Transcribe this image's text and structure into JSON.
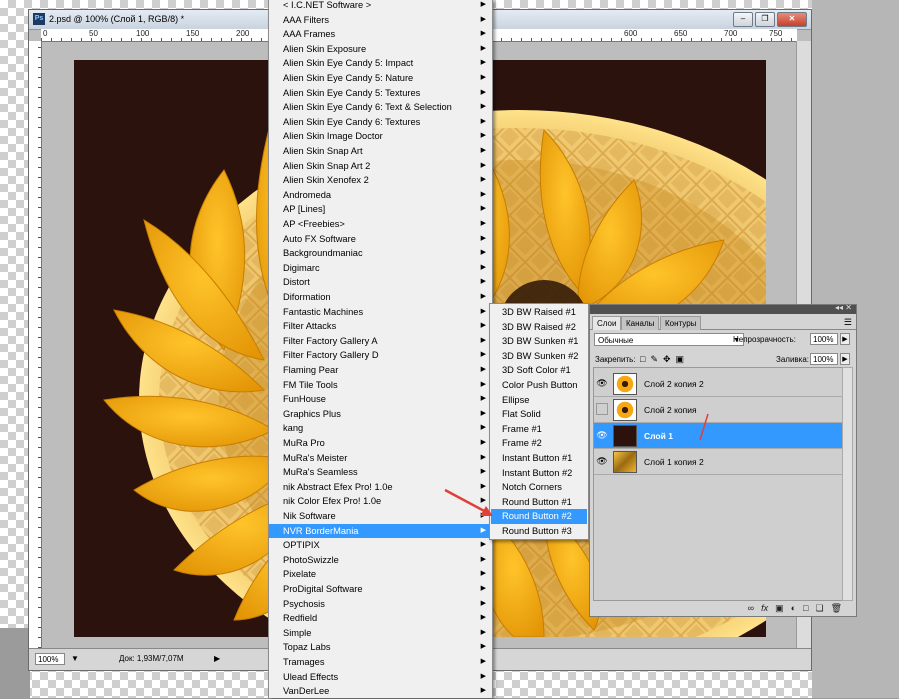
{
  "document": {
    "title": "2.psd @ 100% (Слой 1, RGB/8) *",
    "app_icon": "Ps",
    "ruler_labels": [
      "0",
      "50",
      "100",
      "150",
      "200",
      "250",
      "600",
      "650",
      "700",
      "750",
      "800",
      "850",
      "900"
    ],
    "zoom": "100%",
    "doc_info": "Док: 1,93M/7,07M",
    "canvas_color": "#2b120c"
  },
  "filter_menu": {
    "items": [
      "< I.C.NET Software >",
      "AAA Filters",
      "AAA Frames",
      "Alien Skin Exposure",
      "Alien Skin Eye Candy 5: Impact",
      "Alien Skin Eye Candy 5: Nature",
      "Alien Skin Eye Candy 5: Textures",
      "Alien Skin Eye Candy 6: Text & Selection",
      "Alien Skin Eye Candy 6: Textures",
      "Alien Skin Image Doctor",
      "Alien Skin Snap Art",
      "Alien Skin Snap Art 2",
      "Alien Skin Xenofex 2",
      "Andromeda",
      "AP [Lines]",
      "AP <Freebies>",
      "Auto FX Software",
      "Backgroundmaniac",
      "Digimarc",
      "Distort",
      "Diformation",
      "Fantastic Machines",
      "Filter Attacks",
      "Filter Factory Gallery A",
      "Filter Factory Gallery D",
      "Flaming Pear",
      "FM Tile Tools",
      "FunHouse",
      "Graphics Plus",
      "kang",
      "MuRa Pro",
      "MuRa's Meister",
      "MuRa's Seamless",
      "nik Abstract Efex Pro! 1.0e",
      "nik Color Efex Pro! 1.0e",
      "Nik Software",
      "NVR BorderMania",
      "OPTIPIX",
      "PhotoSwizzle",
      "Pixelate",
      "ProDigital Software",
      "Psychosis",
      "Redfield",
      "Simple",
      "Topaz Labs",
      "Tramages",
      "Ulead Effects",
      "VanDerLee"
    ],
    "highlighted": "NVR BorderMania"
  },
  "submenu": {
    "items": [
      "3D BW Raised #1",
      "3D BW Raised #2",
      "3D BW Sunken #1",
      "3D BW Sunken #2",
      "3D Soft Color #1",
      "Color Push Button",
      "Ellipse",
      "Flat Solid",
      "Frame #1",
      "Frame #2",
      "Instant Button #1",
      "Instant Button #2",
      "Notch Corners",
      "Round Button #1",
      "Round Button #2",
      "Round Button #3"
    ],
    "highlighted": "Round Button #2"
  },
  "layers_panel": {
    "tabs": [
      "Слои",
      "Каналы",
      "Контуры"
    ],
    "blend_mode": "Обычные",
    "opacity_label": "Непрозрачность:",
    "opacity": "100%",
    "lock_label": "Закрепить:",
    "fill_label": "Заливка:",
    "fill": "100%",
    "layers": [
      {
        "name": "Слой 2 копия 2",
        "visible": true,
        "thumb": "flower",
        "selected": false
      },
      {
        "name": "Слой 2 копия",
        "visible": false,
        "thumb": "flower",
        "selected": false
      },
      {
        "name": "Слой 1",
        "visible": true,
        "thumb": "dark",
        "selected": true
      },
      {
        "name": "Слой 1 копия 2",
        "visible": true,
        "thumb": "gold",
        "selected": false
      }
    ]
  },
  "colors": {
    "menu_highlight": "#3399ff",
    "petal": "#f6b21b",
    "annotation_arrow": "#e0403a"
  }
}
